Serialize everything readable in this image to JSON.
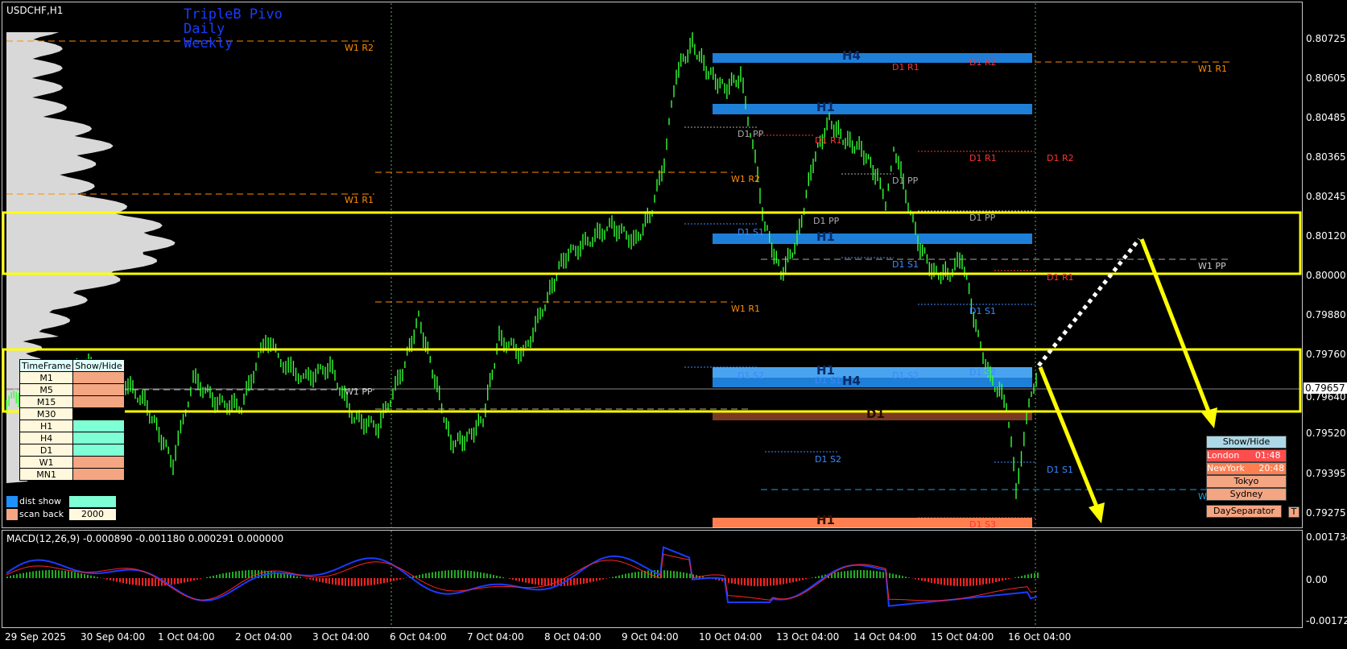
{
  "chart": {
    "symbol": "USDCHF,H1",
    "indicator_lines": [
      "TripleB Pivo",
      "Daily",
      "Weekly"
    ],
    "current_price": "0.79657",
    "price_labels": [
      "0.80725",
      "0.80605",
      "0.80485",
      "0.80365",
      "0.80245",
      "0.80120",
      "0.80000",
      "0.79880",
      "0.79760",
      "0.79640",
      "0.79520",
      "0.79395",
      "0.79275"
    ],
    "date_labels": [
      "29 Sep 2025",
      "30 Sep 04:00",
      "1 Oct 04:00",
      "2 Oct 04:00",
      "3 Oct 04:00",
      "6 Oct 04:00",
      "7 Oct 04:00",
      "8 Oct 04:00",
      "9 Oct 04:00",
      "10 Oct 04:00",
      "13 Oct 04:00",
      "14 Oct 04:00",
      "15 Oct 04:00",
      "16 Oct 04:00"
    ],
    "level_labels": {
      "w1_r2": "W1 R2",
      "w1_r1": "W1 R1",
      "w1_pp": "W1 PP",
      "w1_s1": "W1 S1",
      "d1_r1": "D1 R1",
      "d1_r2": "D1 R2",
      "d1_pp": "D1 PP",
      "d1_s1": "D1 S1",
      "d1_s2": "D1 S2",
      "d1_s3": "D1 S3"
    },
    "zone_labels": {
      "h4": "H4",
      "h1": "H1",
      "d1": "D1"
    }
  },
  "timeframe_panel": {
    "header_name": "TimeFrame",
    "header_show": "Show/Hide",
    "rows": [
      {
        "name": "M1",
        "color": "#f4a582"
      },
      {
        "name": "M5",
        "color": "#f4a582"
      },
      {
        "name": "M15",
        "color": "#f4a582"
      },
      {
        "name": "M30",
        "color": "#000000"
      },
      {
        "name": "H1",
        "color": "#7fffd4"
      },
      {
        "name": "H4",
        "color": "#7fffd4"
      },
      {
        "name": "D1",
        "color": "#7fffd4"
      },
      {
        "name": "W1",
        "color": "#f4a582"
      },
      {
        "name": "MN1",
        "color": "#f4a582"
      }
    ],
    "dist_show_label": "dist show",
    "scan_back_label": "scan back",
    "scan_back_value": "2000"
  },
  "sessions": {
    "show_hide": "Show/Hide",
    "london": "London",
    "london_time": "01:48",
    "newyork": "NewYork",
    "newyork_time": "20:48",
    "tokyo": "Tokyo",
    "sydney": "Sydney",
    "day_separator": "DaySeparator",
    "t_button": "T"
  },
  "macd": {
    "label": "MACD(12,26,9) -0.000890 -0.001180 0.000291 0.000000",
    "scale": [
      "0.001734",
      "0.00",
      "-0.001723"
    ]
  },
  "colors": {
    "accent_yellow": "#ffff00",
    "candle_green": "#33ff33",
    "zone_blue": "#1e7fd8",
    "zone_orange": "#ff7f50",
    "bull_hist": "#22aa22",
    "bear_hist": "#ff2222"
  }
}
